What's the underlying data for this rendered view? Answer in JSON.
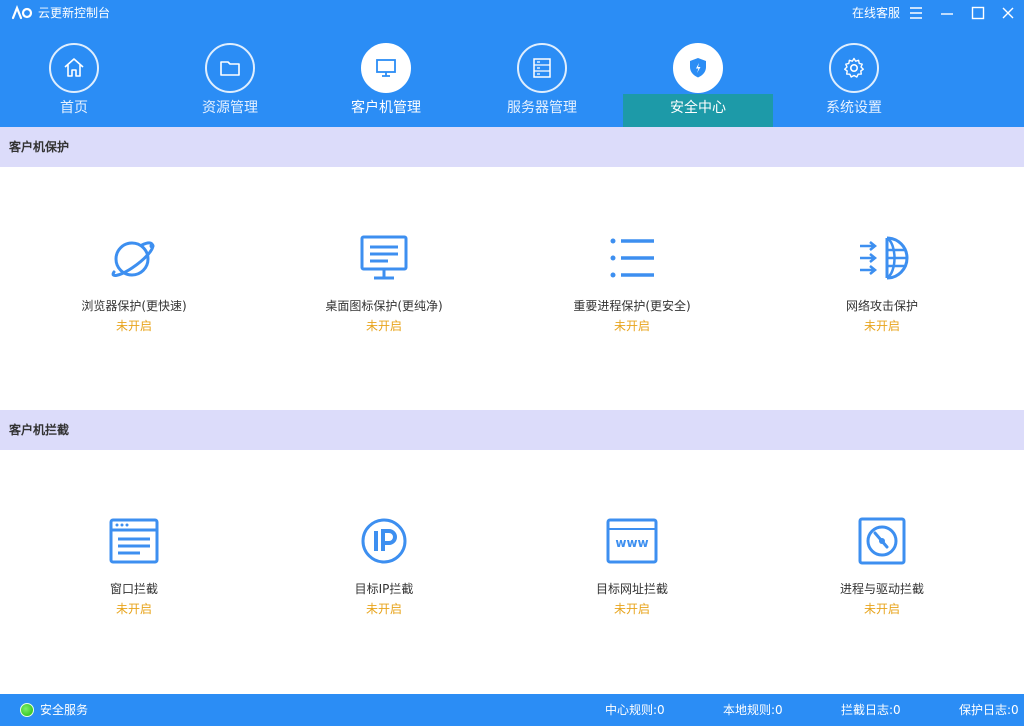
{
  "titlebar": {
    "title": "云更新控制台",
    "support": "在线客服"
  },
  "nav": [
    {
      "label": "首页",
      "icon": "home-icon"
    },
    {
      "label": "资源管理",
      "icon": "folder-icon"
    },
    {
      "label": "客户机管理",
      "icon": "monitor-icon"
    },
    {
      "label": "服务器管理",
      "icon": "server-icon"
    },
    {
      "label": "安全中心",
      "icon": "shield-icon"
    },
    {
      "label": "系统设置",
      "icon": "gear-icon"
    }
  ],
  "sections": {
    "protection": {
      "title": "客户机保护",
      "items": [
        {
          "name": "浏览器保护(更快速)",
          "status": "未开启",
          "icon": "browser-planet-icon"
        },
        {
          "name": "桌面图标保护(更纯净)",
          "status": "未开启",
          "icon": "desktop-monitor-icon"
        },
        {
          "name": "重要进程保护(更安全)",
          "status": "未开启",
          "icon": "process-list-icon"
        },
        {
          "name": "网络攻击保护",
          "status": "未开启",
          "icon": "network-globe-icon"
        }
      ]
    },
    "intercept": {
      "title": "客户机拦截",
      "items": [
        {
          "name": "窗口拦截",
          "status": "未开启",
          "icon": "window-icon"
        },
        {
          "name": "目标IP拦截",
          "status": "未开启",
          "icon": "ip-icon"
        },
        {
          "name": "目标网址拦截",
          "status": "未开启",
          "icon": "www-icon"
        },
        {
          "name": "进程与驱动拦截",
          "status": "未开启",
          "icon": "disk-drive-icon"
        }
      ]
    }
  },
  "statusbar": {
    "service": "安全服务",
    "center_rules": "中心规则:0",
    "local_rules": "本地规则:0",
    "intercept_log": "拦截日志:0",
    "protect_log": "保护日志:0"
  },
  "colors": {
    "primary": "#2b8df5",
    "selected_tab": "#1d9aa8",
    "section_bg": "#dcdcfa",
    "icon_blue": "#3d8ff0",
    "status_orange": "#e8a41c"
  }
}
